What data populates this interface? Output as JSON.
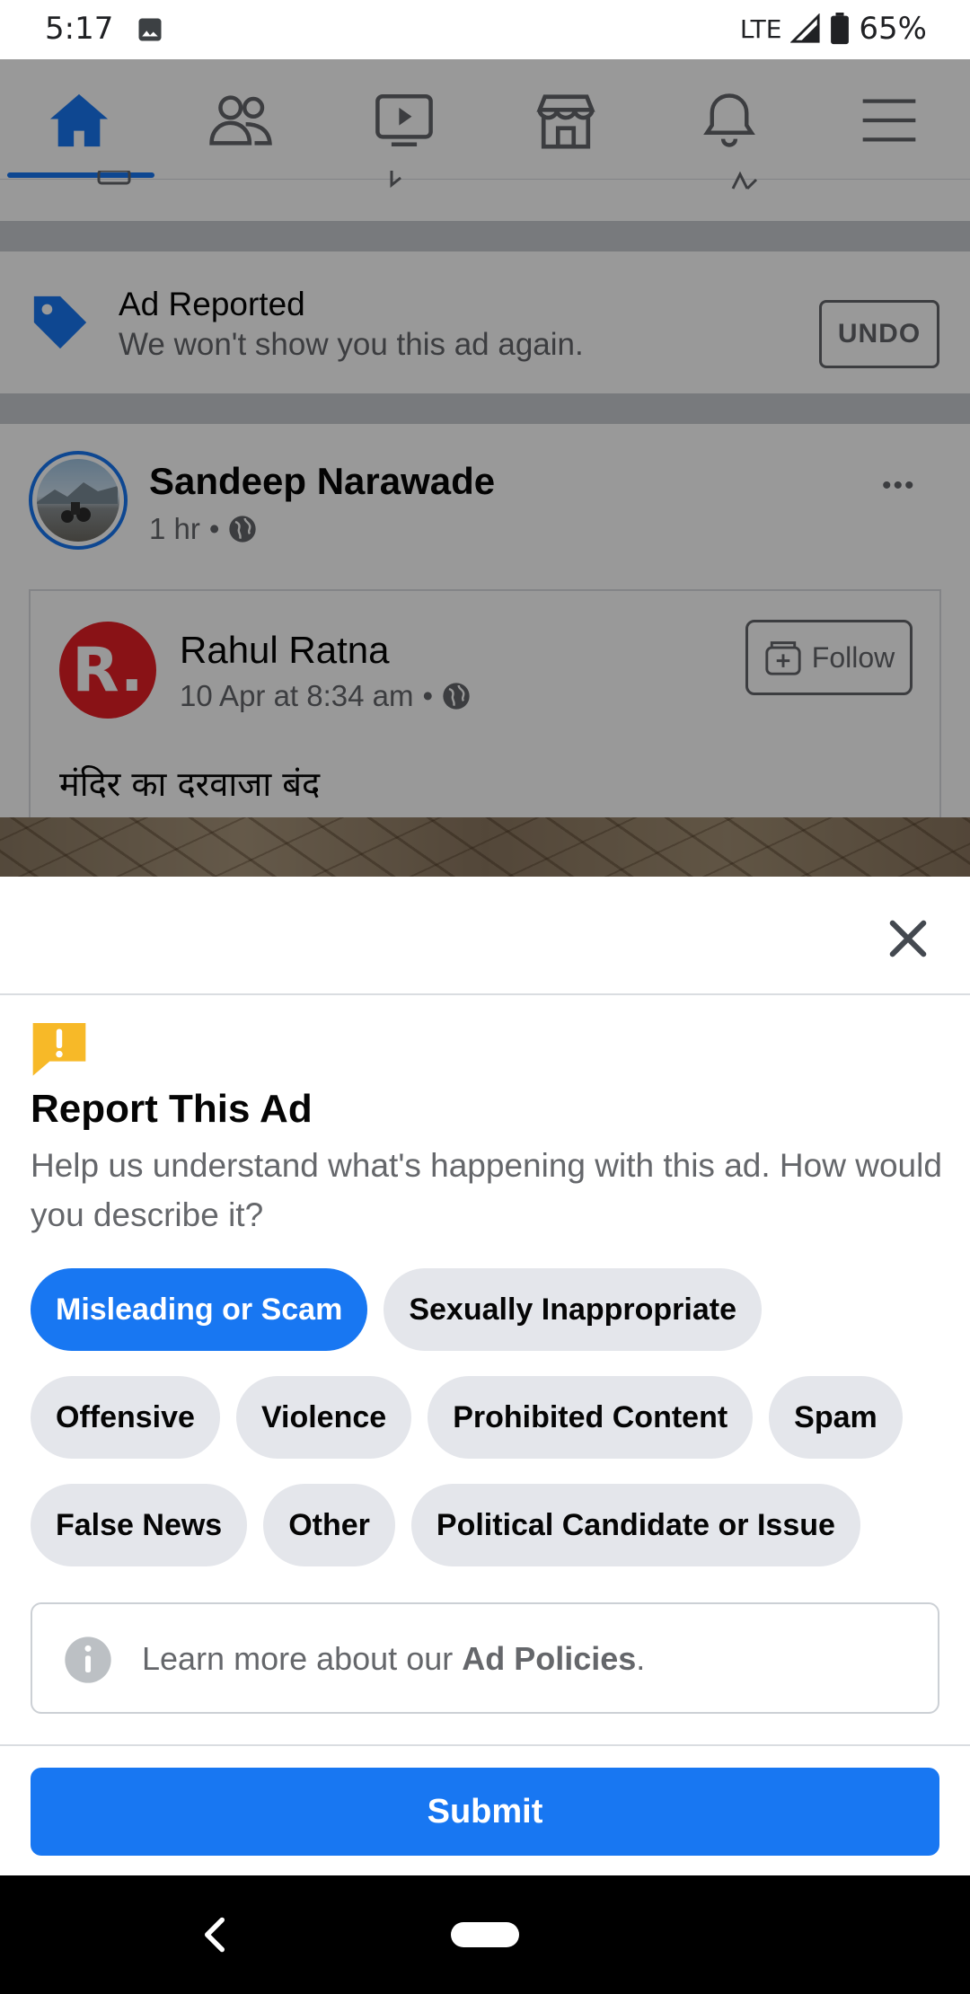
{
  "status_bar": {
    "time": "5:17",
    "network": "LTE",
    "battery": "65%"
  },
  "navbar": {
    "items": [
      "home-icon",
      "friends-icon",
      "watch-icon",
      "marketplace-icon",
      "notifications-icon",
      "menu-icon"
    ],
    "active_color": "#1877f2"
  },
  "ad_reported": {
    "title": "Ad Reported",
    "subtitle": "We won't show you this ad again.",
    "undo_label": "UNDO"
  },
  "post": {
    "author": "Sandeep Narawade",
    "time": "1 hr",
    "separator": "•",
    "more": "•••",
    "shared": {
      "logo_letter": "R.",
      "name": "Rahul Ratna",
      "time": "10 Apr at 8:34 am",
      "separator": "•",
      "follow_label": "Follow",
      "text": "मंदिर का दरवाजा बंद"
    }
  },
  "report_sheet": {
    "title": "Report This Ad",
    "description": "Help us understand what's happening with this ad. How would you describe it?",
    "options": {
      "row1": [
        "Misleading or Scam",
        "Sexually Inappropriate"
      ],
      "row2": [
        "Offensive",
        "Violence",
        "Prohibited Content",
        "Spam"
      ],
      "row3": [
        "False News",
        "Other",
        "Political Candidate or Issue"
      ]
    },
    "selected_option": "Misleading or Scam",
    "policy_prefix": "Learn more about our ",
    "policy_link": "Ad Policies",
    "policy_suffix": ".",
    "submit_label": "Submit"
  },
  "colors": {
    "accent": "#1877f2",
    "warning": "#f7b928",
    "chip_bg": "#e4e6eb"
  }
}
